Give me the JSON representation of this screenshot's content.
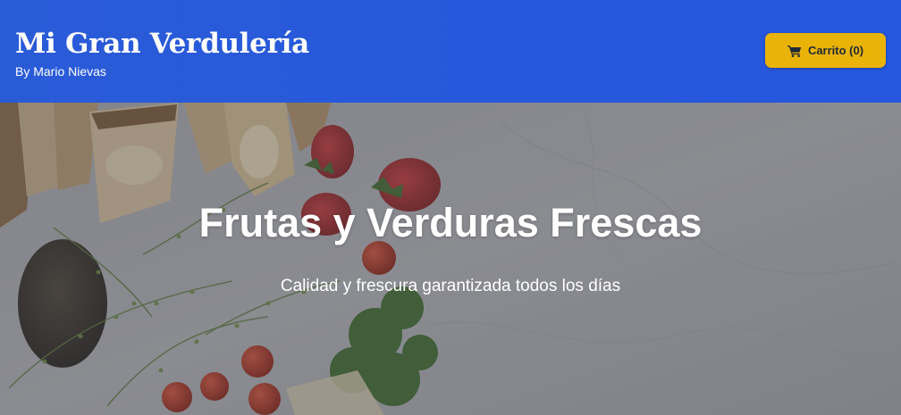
{
  "header": {
    "title": "Mi Gran Verdulería",
    "subtitle": "By Mario Nievas",
    "background_color": "#2658dc",
    "cart_button": {
      "label": "Carrito (0)",
      "icon": "shopping-cart-icon",
      "background_color": "#eab308"
    }
  },
  "hero": {
    "title": "Frutas y Verduras Frescas",
    "subtitle": "Calidad y frescura garantizada todos los días",
    "background_image": "bread, avocado, strawberries, cherry tomatoes, kale and thyme on marble countertop"
  }
}
